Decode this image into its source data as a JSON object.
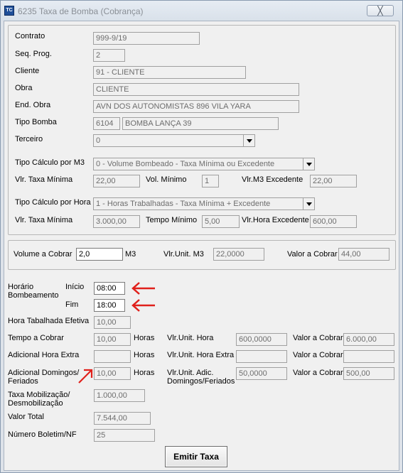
{
  "window": {
    "title": "6235 Taxa de Bomba (Cobrança)",
    "close_label": "╳",
    "icon_label": "TC"
  },
  "contract": {
    "contrato_label": "Contrato",
    "contrato": "999-9/19",
    "seq_label": "Seq. Prog.",
    "seq": "2",
    "cliente_label": "Cliente",
    "cliente": "91 - CLIENTE",
    "obra_label": "Obra",
    "obra": "CLIENTE",
    "end_label": "End. Obra",
    "end": "AVN DOS AUTONOMISTAS 896  VILA YARA",
    "tipo_bomba_label": "Tipo Bomba",
    "tipo_bomba_code": "6104",
    "tipo_bomba_name": "BOMBA LANÇA 39",
    "terceiro_label": "Terceiro",
    "terceiro": "0",
    "calc_m3_label": "Tipo Cálculo por M3",
    "calc_m3": "0 - Volume Bombeado - Taxa Mínima ou Excedente",
    "vtm1_label": "Vlr. Taxa Mínima",
    "vtm1": "22,00",
    "vol_min_label": "Vol. Mínimo",
    "vol_min": "1",
    "m3_exc_label": "Vlr.M3 Excedente",
    "m3_exc": "22,00",
    "calc_hora_label": "Tipo Cálculo por Hora",
    "calc_hora": "1 - Horas Trabalhadas - Taxa Mínima + Excedente",
    "vtm2_label": "Vlr. Taxa Mínima",
    "vtm2": "3.000,00",
    "tempo_min_label": "Tempo Mínimo",
    "tempo_min": "5,00",
    "hora_exc_label": "Vlr.Hora Excedente",
    "hora_exc": "600,00"
  },
  "volume": {
    "vol_label": "Volume a Cobrar",
    "vol": "2,0",
    "unit": "M3",
    "vunit_label": "Vlr.Unit. M3",
    "vunit": "22,0000",
    "valor_label": "Valor a Cobrar",
    "valor": "44,00"
  },
  "horario": {
    "label": "Horário Bombeamento",
    "inicio_label": "Início",
    "inicio": "08:00",
    "fim_label": "Fim",
    "fim": "18:00",
    "efetiva_label": "Hora Tabalhada Efetiva",
    "efetiva": "10,00",
    "tempo_label": "Tempo a Cobrar",
    "tempo": "10,00",
    "horas1": "Horas",
    "vu_hora_label": "Vlr.Unit. Hora",
    "vu_hora": "600,0000",
    "valor1_label": "Valor a Cobrar",
    "valor1": "6.000,00",
    "extra_label": "Adicional Hora Extra",
    "extra": "",
    "horas2": "Horas",
    "vu_extra_label": "Vlr.Unit. Hora Extra",
    "vu_extra": "",
    "valor2_label": "Valor a Cobrar",
    "valor2": "",
    "dom_label": "Adicional Domingos/ Feriados",
    "dom": "10,00",
    "horas3": "Horas",
    "vu_dom_label": "Vlr.Unit. Adic. Domingos/Feriados",
    "vu_dom": "50,0000",
    "valor3_label": "Valor a Cobrar",
    "valor3": "500,00",
    "mob_label": "Taxa Mobilização/ Desmobilização",
    "mob": "1.000,00",
    "total_label": "Valor Total",
    "total": "7.544,00",
    "boletim_label": "Número Boletim/NF",
    "boletim": "25"
  },
  "actions": {
    "emitir": "Emitir Taxa"
  },
  "colors": {
    "annotation_arrow": "#e0201b"
  }
}
